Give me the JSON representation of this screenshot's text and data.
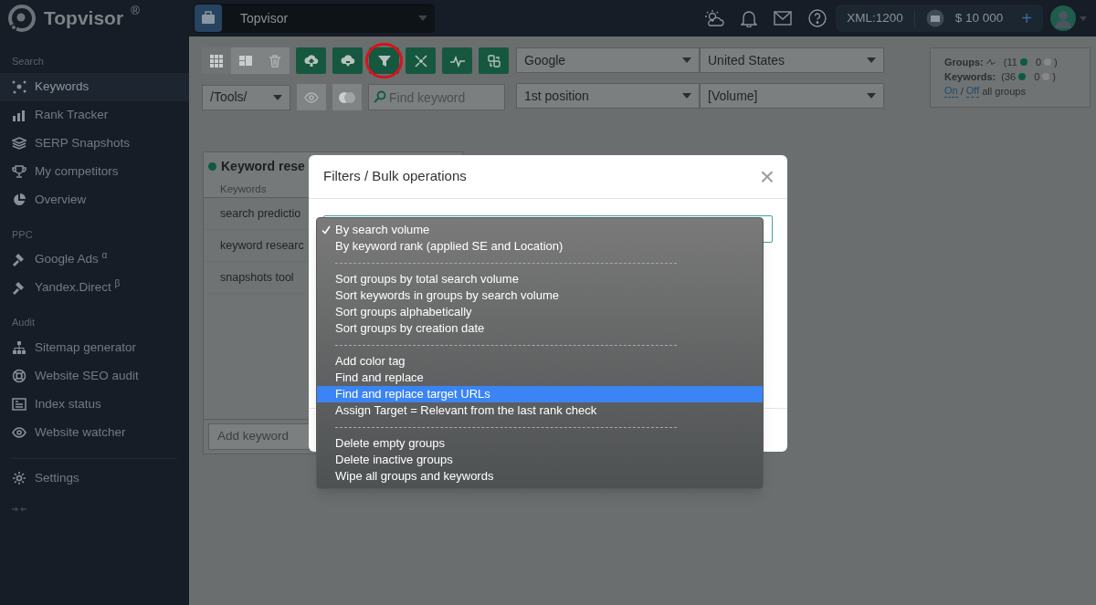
{
  "brand": {
    "name": "Topvisor",
    "mark": "®"
  },
  "project_selector": {
    "value": "Topvisor"
  },
  "header": {
    "xml": "XML:1200",
    "balance": "$ 10 000",
    "plus": "+"
  },
  "sidebar": {
    "sections": [
      {
        "label": "Search",
        "items": [
          {
            "label": "Keywords",
            "selected": true
          },
          {
            "label": "Rank Tracker",
            "selected": false
          },
          {
            "label": "SERP Snapshots",
            "selected": false
          },
          {
            "label": "My competitors",
            "selected": false
          },
          {
            "label": "Overview",
            "selected": false
          }
        ]
      },
      {
        "label": "PPC",
        "items": [
          {
            "label": "Google Ads $^{α}$",
            "selected": false
          },
          {
            "label": "Yandex.Direct $^{β}$",
            "selected": false
          }
        ]
      },
      {
        "label": "Audit",
        "items": [
          {
            "label": "Sitemap generator",
            "selected": false
          },
          {
            "label": "Website SEO audit",
            "selected": false
          },
          {
            "label": "Index status",
            "selected": false
          },
          {
            "label": "Website watcher",
            "selected": false
          }
        ]
      }
    ],
    "settings": {
      "label": "Settings"
    }
  },
  "toolbar": {
    "view_buttons": [
      {
        "selected": true
      },
      {
        "selected": false
      },
      {
        "selected": false
      }
    ],
    "action_buttons": [
      {
        "circled": false
      },
      {
        "circled": false
      },
      {
        "circled": true
      },
      {
        "circled": false
      },
      {
        "circled": false
      },
      {
        "circled": false
      }
    ],
    "search_engine": "Google",
    "region": "United States",
    "folder": "/Tools/",
    "search": {
      "placeholder": "Find keyword"
    },
    "position": "1st position",
    "volume": "[Volume]"
  },
  "stats": {
    "groups_label": "Groups:",
    "groups_count": "(11",
    "groups_off": "0",
    "groups_end": ")",
    "keywords_label": "Keywords:",
    "keywords_count": "(36",
    "keywords_off": "0",
    "keywords_end": ")",
    "on": "On",
    "slash": "/",
    "off": "Off",
    "rest": "all groups"
  },
  "keyword_panel": {
    "title": "Keyword rese",
    "column": "Keywords",
    "rows": [
      "search predictio",
      "keyword researc",
      "snapshots tool"
    ],
    "add": {
      "placeholder": "Add keyword"
    }
  },
  "dialog": {
    "title": "Filters / Bulk operations",
    "close": "×",
    "menu": [
      {
        "kind": "option",
        "label": "By search volume",
        "checked": true,
        "highlighted": false
      },
      {
        "kind": "option",
        "label": "By keyword rank (applied SE and Location)",
        "checked": false,
        "highlighted": false
      },
      {
        "kind": "separator"
      },
      {
        "kind": "option",
        "label": "Sort groups by total search volume",
        "checked": false,
        "highlighted": false
      },
      {
        "kind": "option",
        "label": "Sort keywords in groups by search volume",
        "checked": false,
        "highlighted": false
      },
      {
        "kind": "option",
        "label": "Sort groups alphabetically",
        "checked": false,
        "highlighted": false
      },
      {
        "kind": "option",
        "label": "Sort groups by creation date",
        "checked": false,
        "highlighted": false
      },
      {
        "kind": "separator"
      },
      {
        "kind": "option",
        "label": "Add color tag",
        "checked": false,
        "highlighted": false
      },
      {
        "kind": "option",
        "label": "Find and replace",
        "checked": false,
        "highlighted": false
      },
      {
        "kind": "option",
        "label": "Find and replace target URLs",
        "checked": false,
        "highlighted": true
      },
      {
        "kind": "option",
        "label": "Assign Target = Relevant from the last rank check",
        "checked": false,
        "highlighted": false
      },
      {
        "kind": "separator"
      },
      {
        "kind": "option",
        "label": "Delete empty groups",
        "checked": false,
        "highlighted": false
      },
      {
        "kind": "option",
        "label": "Delete inactive groups",
        "checked": false,
        "highlighted": false
      },
      {
        "kind": "option",
        "label": "Wipe all groups and keywords",
        "checked": false,
        "highlighted": false
      }
    ]
  }
}
